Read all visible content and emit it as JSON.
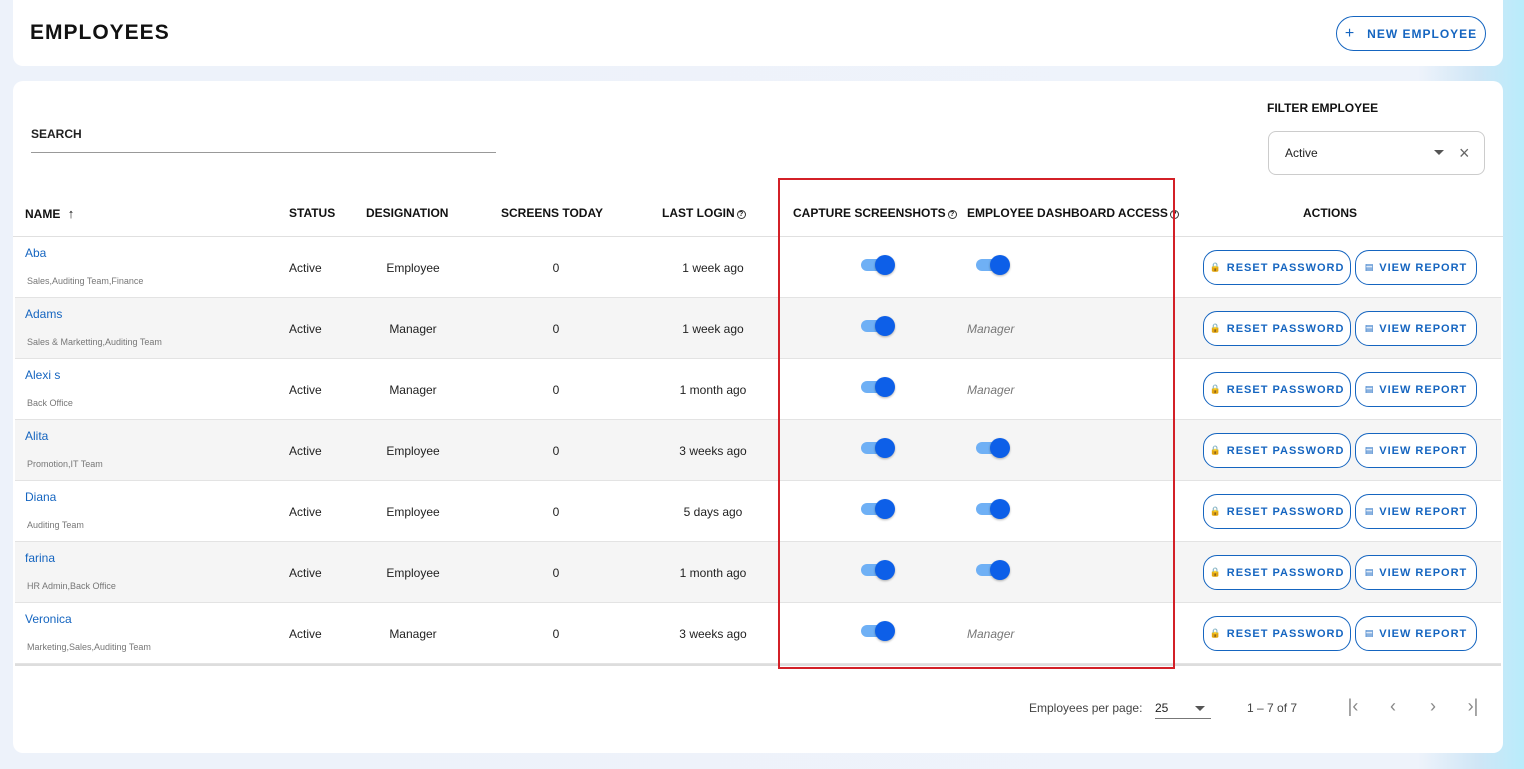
{
  "header": {
    "title": "EMPLOYEES",
    "new_button_label": "NEW EMPLOYEE"
  },
  "search": {
    "label": "SEARCH"
  },
  "filter": {
    "label": "FILTER EMPLOYEE",
    "value": "Active"
  },
  "columns": {
    "name": "NAME",
    "status": "STATUS",
    "designation": "DESIGNATION",
    "screens_today": "SCREENS TODAY",
    "last_login": "LAST LOGIN",
    "capture_screenshots": "CAPTURE SCREENSHOTS",
    "dashboard_access": "EMPLOYEE DASHBOARD ACCESS",
    "actions": "ACTIONS"
  },
  "actions": {
    "reset_label": "RESET PASSWORD",
    "view_label": "VIEW REPORT"
  },
  "rows": [
    {
      "name": "Aba",
      "teams": "Sales,Auditing Team,Finance",
      "status": "Active",
      "designation": "Employee",
      "screens": "0",
      "last_login": "1 week ago",
      "capture": true,
      "dashboard": "toggle"
    },
    {
      "name": "Adams",
      "teams": "Sales & Marketting,Auditing Team",
      "status": "Active",
      "designation": "Manager",
      "screens": "0",
      "last_login": "1 week ago",
      "capture": true,
      "dashboard": "Manager"
    },
    {
      "name": "Alexi s",
      "teams": "Back Office",
      "status": "Active",
      "designation": "Manager",
      "screens": "0",
      "last_login": "1 month ago",
      "capture": true,
      "dashboard": "Manager"
    },
    {
      "name": "Alita",
      "teams": "Promotion,IT Team",
      "status": "Active",
      "designation": "Employee",
      "screens": "0",
      "last_login": "3 weeks ago",
      "capture": true,
      "dashboard": "toggle"
    },
    {
      "name": "Diana",
      "teams": "Auditing Team",
      "status": "Active",
      "designation": "Employee",
      "screens": "0",
      "last_login": "5 days ago",
      "capture": true,
      "dashboard": "toggle"
    },
    {
      "name": "farina",
      "teams": "HR Admin,Back Office",
      "status": "Active",
      "designation": "Employee",
      "screens": "0",
      "last_login": "1 month ago",
      "capture": true,
      "dashboard": "toggle"
    },
    {
      "name": "Veronica",
      "teams": "Marketing,Sales,Auditing Team",
      "status": "Active",
      "designation": "Manager",
      "screens": "0",
      "last_login": "3 weeks ago",
      "capture": true,
      "dashboard": "Manager"
    }
  ],
  "pagination": {
    "per_page_label": "Employees per page:",
    "per_page_value": "25",
    "range": "1 – 7 of 7"
  },
  "colors": {
    "accent": "#1565c0",
    "toggle_on": "#0d5fe8",
    "highlight": "#d32027"
  }
}
